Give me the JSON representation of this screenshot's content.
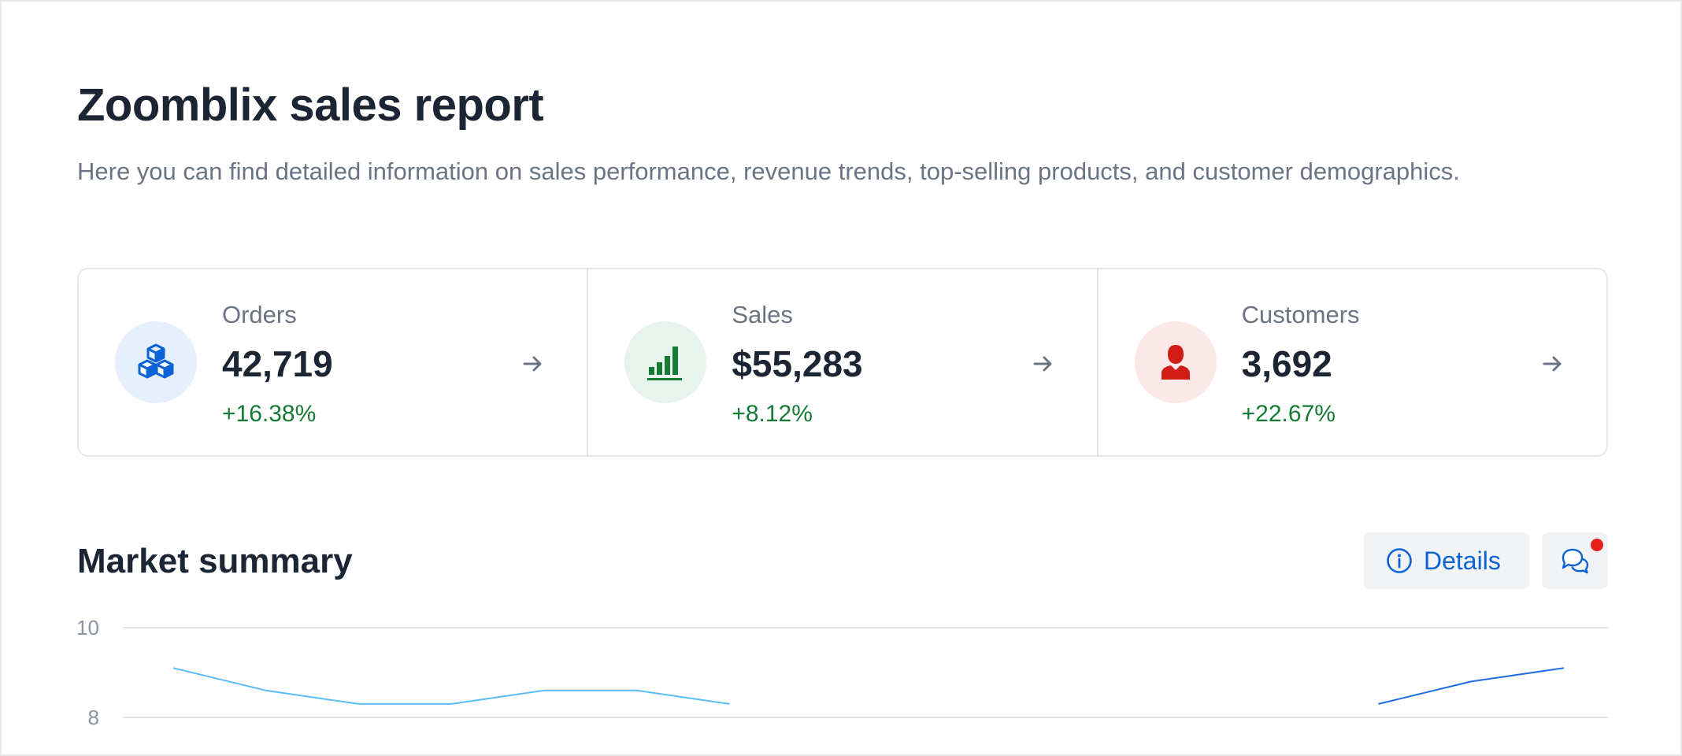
{
  "header": {
    "title": "Zoomblix sales report",
    "subtitle": "Here you can find detailed information on sales performance, revenue trends, top-selling products, and customer demographics."
  },
  "kpis": [
    {
      "label": "Orders",
      "value": "42,719",
      "change": "+16.38%",
      "icon": "cubes-icon",
      "icon_color": "#0b63d6",
      "icon_bg": "#e6f0fd",
      "change_color": "#157a34"
    },
    {
      "label": "Sales",
      "value": "$55,283",
      "change": "+8.12%",
      "icon": "bar-chart-icon",
      "icon_color": "#157a34",
      "icon_bg": "#e7f3ec",
      "change_color": "#157a34"
    },
    {
      "label": "Customers",
      "value": "3,692",
      "change": "+22.67%",
      "icon": "user-icon",
      "icon_color": "#d21d16",
      "icon_bg": "#fde8e8",
      "change_color": "#157a34"
    }
  ],
  "market_summary": {
    "title": "Market summary",
    "details_label": "Details",
    "has_notification": true
  },
  "chart_data": {
    "type": "line",
    "y_ticks": [
      "10",
      "8"
    ],
    "ylim_visible": [
      7,
      10
    ],
    "series": [
      {
        "color": "#57bdf2",
        "points": [
          [
            0,
            9.1
          ],
          [
            1,
            8.6
          ],
          [
            2,
            8.3
          ],
          [
            3,
            8.3
          ],
          [
            4,
            8.6
          ],
          [
            5,
            8.6
          ],
          [
            6,
            8.3
          ]
        ]
      },
      {
        "color": "#1d6fe0",
        "points": [
          [
            13,
            8.3
          ],
          [
            14,
            8.8
          ],
          [
            15,
            9.1
          ]
        ]
      }
    ],
    "x_count": 16,
    "grid": true,
    "colors": {
      "grid": "#dfe3e8"
    }
  }
}
